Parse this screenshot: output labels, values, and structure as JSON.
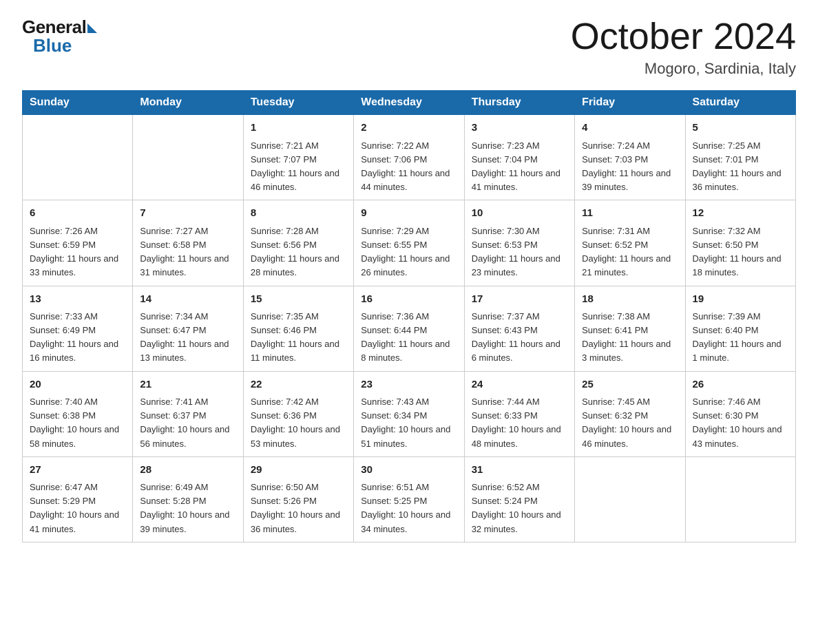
{
  "logo": {
    "general": "General",
    "blue": "Blue"
  },
  "title": "October 2024",
  "subtitle": "Mogoro, Sardinia, Italy",
  "days_of_week": [
    "Sunday",
    "Monday",
    "Tuesday",
    "Wednesday",
    "Thursday",
    "Friday",
    "Saturday"
  ],
  "weeks": [
    [
      {
        "day": "",
        "sunrise": "",
        "sunset": "",
        "daylight": ""
      },
      {
        "day": "",
        "sunrise": "",
        "sunset": "",
        "daylight": ""
      },
      {
        "day": "1",
        "sunrise": "Sunrise: 7:21 AM",
        "sunset": "Sunset: 7:07 PM",
        "daylight": "Daylight: 11 hours and 46 minutes."
      },
      {
        "day": "2",
        "sunrise": "Sunrise: 7:22 AM",
        "sunset": "Sunset: 7:06 PM",
        "daylight": "Daylight: 11 hours and 44 minutes."
      },
      {
        "day": "3",
        "sunrise": "Sunrise: 7:23 AM",
        "sunset": "Sunset: 7:04 PM",
        "daylight": "Daylight: 11 hours and 41 minutes."
      },
      {
        "day": "4",
        "sunrise": "Sunrise: 7:24 AM",
        "sunset": "Sunset: 7:03 PM",
        "daylight": "Daylight: 11 hours and 39 minutes."
      },
      {
        "day": "5",
        "sunrise": "Sunrise: 7:25 AM",
        "sunset": "Sunset: 7:01 PM",
        "daylight": "Daylight: 11 hours and 36 minutes."
      }
    ],
    [
      {
        "day": "6",
        "sunrise": "Sunrise: 7:26 AM",
        "sunset": "Sunset: 6:59 PM",
        "daylight": "Daylight: 11 hours and 33 minutes."
      },
      {
        "day": "7",
        "sunrise": "Sunrise: 7:27 AM",
        "sunset": "Sunset: 6:58 PM",
        "daylight": "Daylight: 11 hours and 31 minutes."
      },
      {
        "day": "8",
        "sunrise": "Sunrise: 7:28 AM",
        "sunset": "Sunset: 6:56 PM",
        "daylight": "Daylight: 11 hours and 28 minutes."
      },
      {
        "day": "9",
        "sunrise": "Sunrise: 7:29 AM",
        "sunset": "Sunset: 6:55 PM",
        "daylight": "Daylight: 11 hours and 26 minutes."
      },
      {
        "day": "10",
        "sunrise": "Sunrise: 7:30 AM",
        "sunset": "Sunset: 6:53 PM",
        "daylight": "Daylight: 11 hours and 23 minutes."
      },
      {
        "day": "11",
        "sunrise": "Sunrise: 7:31 AM",
        "sunset": "Sunset: 6:52 PM",
        "daylight": "Daylight: 11 hours and 21 minutes."
      },
      {
        "day": "12",
        "sunrise": "Sunrise: 7:32 AM",
        "sunset": "Sunset: 6:50 PM",
        "daylight": "Daylight: 11 hours and 18 minutes."
      }
    ],
    [
      {
        "day": "13",
        "sunrise": "Sunrise: 7:33 AM",
        "sunset": "Sunset: 6:49 PM",
        "daylight": "Daylight: 11 hours and 16 minutes."
      },
      {
        "day": "14",
        "sunrise": "Sunrise: 7:34 AM",
        "sunset": "Sunset: 6:47 PM",
        "daylight": "Daylight: 11 hours and 13 minutes."
      },
      {
        "day": "15",
        "sunrise": "Sunrise: 7:35 AM",
        "sunset": "Sunset: 6:46 PM",
        "daylight": "Daylight: 11 hours and 11 minutes."
      },
      {
        "day": "16",
        "sunrise": "Sunrise: 7:36 AM",
        "sunset": "Sunset: 6:44 PM",
        "daylight": "Daylight: 11 hours and 8 minutes."
      },
      {
        "day": "17",
        "sunrise": "Sunrise: 7:37 AM",
        "sunset": "Sunset: 6:43 PM",
        "daylight": "Daylight: 11 hours and 6 minutes."
      },
      {
        "day": "18",
        "sunrise": "Sunrise: 7:38 AM",
        "sunset": "Sunset: 6:41 PM",
        "daylight": "Daylight: 11 hours and 3 minutes."
      },
      {
        "day": "19",
        "sunrise": "Sunrise: 7:39 AM",
        "sunset": "Sunset: 6:40 PM",
        "daylight": "Daylight: 11 hours and 1 minute."
      }
    ],
    [
      {
        "day": "20",
        "sunrise": "Sunrise: 7:40 AM",
        "sunset": "Sunset: 6:38 PM",
        "daylight": "Daylight: 10 hours and 58 minutes."
      },
      {
        "day": "21",
        "sunrise": "Sunrise: 7:41 AM",
        "sunset": "Sunset: 6:37 PM",
        "daylight": "Daylight: 10 hours and 56 minutes."
      },
      {
        "day": "22",
        "sunrise": "Sunrise: 7:42 AM",
        "sunset": "Sunset: 6:36 PM",
        "daylight": "Daylight: 10 hours and 53 minutes."
      },
      {
        "day": "23",
        "sunrise": "Sunrise: 7:43 AM",
        "sunset": "Sunset: 6:34 PM",
        "daylight": "Daylight: 10 hours and 51 minutes."
      },
      {
        "day": "24",
        "sunrise": "Sunrise: 7:44 AM",
        "sunset": "Sunset: 6:33 PM",
        "daylight": "Daylight: 10 hours and 48 minutes."
      },
      {
        "day": "25",
        "sunrise": "Sunrise: 7:45 AM",
        "sunset": "Sunset: 6:32 PM",
        "daylight": "Daylight: 10 hours and 46 minutes."
      },
      {
        "day": "26",
        "sunrise": "Sunrise: 7:46 AM",
        "sunset": "Sunset: 6:30 PM",
        "daylight": "Daylight: 10 hours and 43 minutes."
      }
    ],
    [
      {
        "day": "27",
        "sunrise": "Sunrise: 6:47 AM",
        "sunset": "Sunset: 5:29 PM",
        "daylight": "Daylight: 10 hours and 41 minutes."
      },
      {
        "day": "28",
        "sunrise": "Sunrise: 6:49 AM",
        "sunset": "Sunset: 5:28 PM",
        "daylight": "Daylight: 10 hours and 39 minutes."
      },
      {
        "day": "29",
        "sunrise": "Sunrise: 6:50 AM",
        "sunset": "Sunset: 5:26 PM",
        "daylight": "Daylight: 10 hours and 36 minutes."
      },
      {
        "day": "30",
        "sunrise": "Sunrise: 6:51 AM",
        "sunset": "Sunset: 5:25 PM",
        "daylight": "Daylight: 10 hours and 34 minutes."
      },
      {
        "day": "31",
        "sunrise": "Sunrise: 6:52 AM",
        "sunset": "Sunset: 5:24 PM",
        "daylight": "Daylight: 10 hours and 32 minutes."
      },
      {
        "day": "",
        "sunrise": "",
        "sunset": "",
        "daylight": ""
      },
      {
        "day": "",
        "sunrise": "",
        "sunset": "",
        "daylight": ""
      }
    ]
  ]
}
